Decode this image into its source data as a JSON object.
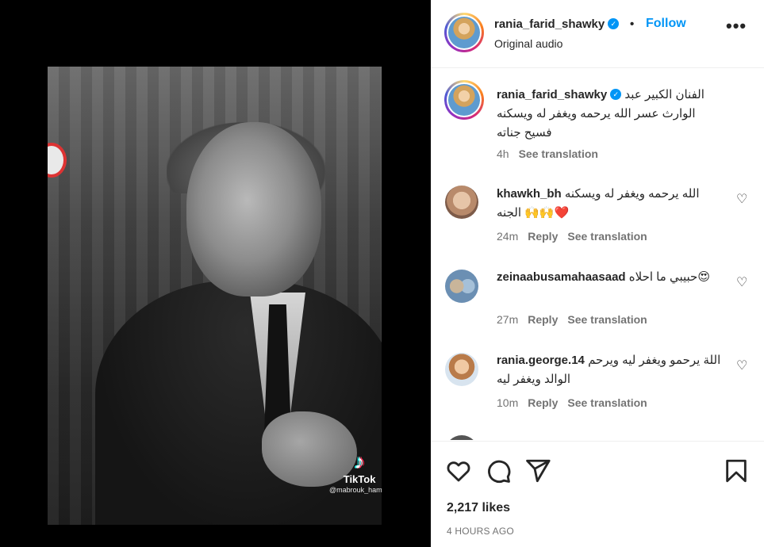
{
  "video": {
    "watermark_name": "TikTok",
    "watermark_user": "@mabrouk_hamdy"
  },
  "header": {
    "username": "rania_farid_shawky",
    "separator": "•",
    "follow_label": "Follow",
    "subtitle": "Original audio",
    "more_icon": "more-horizontal-icon"
  },
  "caption": {
    "username": "rania_farid_shawky",
    "text": "الفنان الكبير عبد الوارث عسر الله يرحمه ويغفر له ويسكنه فسيح جناته",
    "time": "4h",
    "see_translation": "See translation"
  },
  "comments": [
    {
      "username": "khawkh_bh",
      "text": "الله يرحمه ويغفر له ويسكنه الجنه 🙌🙌❤️",
      "time": "24m",
      "reply": "Reply",
      "see_translation": "See translation"
    },
    {
      "username": "zeinaabusamahaasaad",
      "text": "حبيبي ما احلاه😍",
      "time": "27m",
      "reply": "Reply",
      "see_translation": "See translation"
    },
    {
      "username": "rania.george.14",
      "text": "اللة يرحمو ويغفر ليه ويرحم الوالد ويغفر ليه",
      "time": "10m",
      "reply": "Reply",
      "see_translation": "See translation"
    }
  ],
  "likes": "2,217 likes",
  "time_ago": "4 HOURS AGO",
  "colors": {
    "accent": "#0095f6",
    "text": "#262626",
    "muted": "#737373"
  }
}
